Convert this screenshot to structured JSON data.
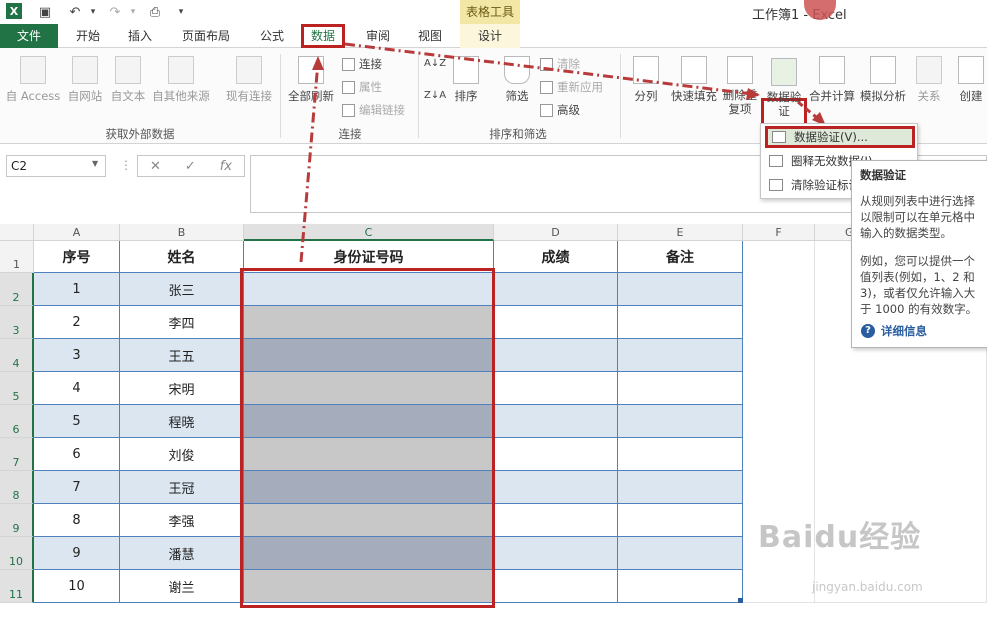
{
  "window": {
    "title": "工作簿1 - Excel",
    "context_tab_group": "表格工具"
  },
  "tabs": [
    {
      "label": "文件"
    },
    {
      "label": "开始"
    },
    {
      "label": "插入"
    },
    {
      "label": "页面布局"
    },
    {
      "label": "公式"
    },
    {
      "label": "数据"
    },
    {
      "label": "审阅"
    },
    {
      "label": "视图"
    },
    {
      "label": "设计"
    }
  ],
  "active_tab": "数据",
  "ribbon": {
    "get_external": {
      "label": "获取外部数据",
      "buttons": [
        "自 Access",
        "自网站",
        "自文本",
        "自其他来源",
        "现有连接"
      ]
    },
    "connections": {
      "label": "连接",
      "refresh": "全部刷新",
      "items": [
        "连接",
        "属性",
        "编辑链接"
      ]
    },
    "sort_filter": {
      "label": "排序和筛选",
      "sort": "排序",
      "filter": "筛选",
      "items": [
        "清除",
        "重新应用",
        "高级"
      ]
    },
    "tools": {
      "split": "分列",
      "flash_fill": "快速填充",
      "remove_dup": "删除重复项",
      "data_validation": "数据验证",
      "consolidate": "合并计算",
      "what_if": "模拟分析",
      "relations": "关系",
      "create": "创建"
    }
  },
  "dv_menu": {
    "items": [
      "数据验证(V)...",
      "圈释无效数据(I)",
      "清除验证标识圈(R)"
    ]
  },
  "tooltip": {
    "title": "数据验证",
    "body1": "从规则列表中进行选择以限制可以在单元格中输入的数据类型。",
    "body2": "例如，您可以提供一个值列表(例如，1、2 和 3)，或者仅允许输入大于 1000 的有效数字。",
    "more": "详细信息"
  },
  "name_box": "C2",
  "fx": "fx",
  "columns": [
    "A",
    "B",
    "C",
    "D",
    "E",
    "F",
    "G"
  ],
  "rows": [
    "1",
    "2",
    "3",
    "4",
    "5",
    "6",
    "7",
    "8",
    "9",
    "10",
    "11"
  ],
  "table": {
    "headers": [
      "序号",
      "姓名",
      "身份证号码",
      "成绩",
      "备注"
    ],
    "data": [
      [
        "1",
        "张三"
      ],
      [
        "2",
        "李四"
      ],
      [
        "3",
        "王五"
      ],
      [
        "4",
        "宋明"
      ],
      [
        "5",
        "程晓"
      ],
      [
        "6",
        "刘俊"
      ],
      [
        "7",
        "王冠"
      ],
      [
        "8",
        "李强"
      ],
      [
        "9",
        "潘慧"
      ],
      [
        "10",
        "谢兰"
      ]
    ]
  },
  "watermark": {
    "main": "Baidu经验",
    "sub": "jingyan.baidu.com"
  }
}
